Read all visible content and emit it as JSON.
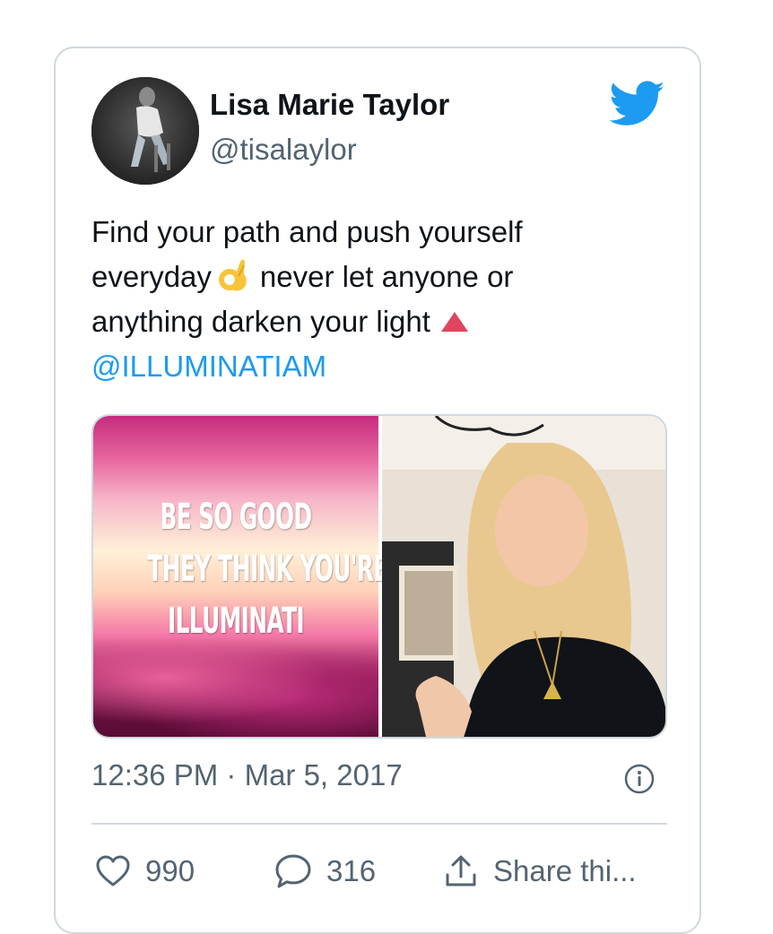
{
  "author": {
    "name": "Lisa Marie Taylor",
    "handle": "@tisalaylor"
  },
  "tweet": {
    "line1": "Find your path and push yourself",
    "line2_before": "everyday",
    "line2_after": "never let anyone or",
    "line3": "anything darken your light",
    "mention": "@ILLUMINATIAM"
  },
  "media": {
    "quote_lines": [
      "BE SO GOOD",
      "THEY THINK YOU'RE",
      "ILLUMINATI"
    ]
  },
  "meta": {
    "timestamp": "12:36 PM · Mar 5, 2017"
  },
  "actions": {
    "likes": "990",
    "replies": "316",
    "share_label": "Share thi..."
  },
  "colors": {
    "brand": "#1d9bf0",
    "text": "#0f1419",
    "muted": "#536471",
    "border": "#cfd9de",
    "triangle": "#e0245e"
  },
  "icons": [
    "twitter-bird-icon",
    "ok-hand-emoji-icon",
    "red-triangle-emoji-icon",
    "info-icon",
    "heart-icon",
    "reply-bubble-icon",
    "share-icon"
  ]
}
